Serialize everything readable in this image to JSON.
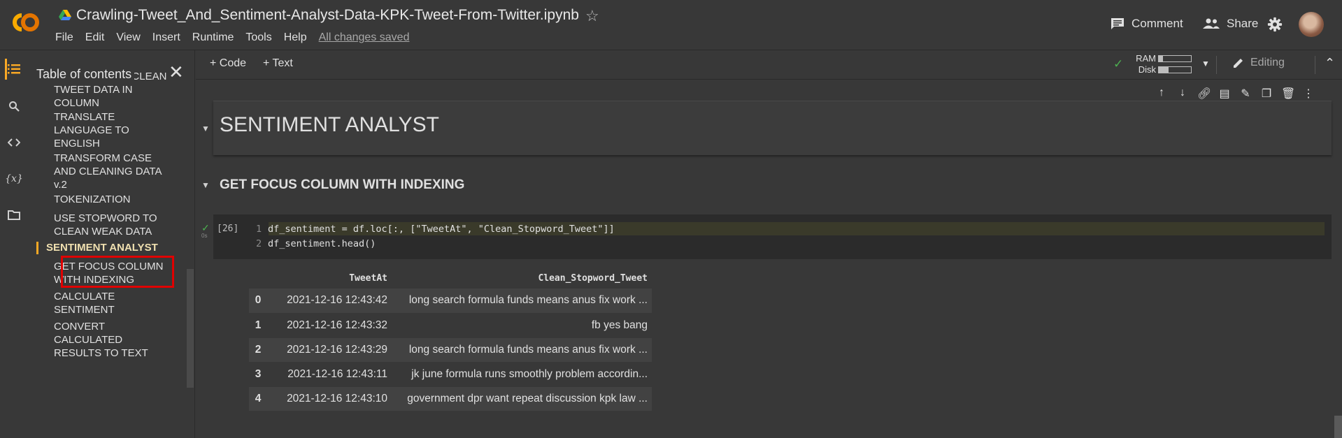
{
  "app": {
    "title": "Crawling-Tweet_And_Sentiment-Analyst-Data-KPK-Tweet-From-Twitter.ipynb",
    "menu": [
      "File",
      "Edit",
      "View",
      "Insert",
      "Runtime",
      "Tools",
      "Help"
    ],
    "save_status": "All changes saved",
    "comment_label": "Comment",
    "share_label": "Share"
  },
  "toc": {
    "title": "Table of contents",
    "items": [
      "ANALYSIS AND CLEAN TWEET DATA IN COLUMN",
      "TRANSLATE LANGUAGE TO ENGLISH",
      "TRANSFORM CASE AND CLEANING DATA v.2",
      "TOKENIZATION",
      "USE STOPWORD TO CLEAN WEAK DATA",
      "SENTIMENT ANALYST",
      "GET FOCUS COLUMN WITH INDEXING",
      "CALCULATE SENTIMENT",
      "CONVERT CALCULATED RESULTS TO TEXT"
    ]
  },
  "toolbar": {
    "code_label": "Code",
    "text_label": "Text",
    "ram_label": "RAM",
    "disk_label": "Disk",
    "ram_usage": 0.12,
    "disk_usage": 0.3,
    "editing_label": "Editing"
  },
  "notebook": {
    "heading1": "SENTIMENT ANALYST",
    "heading2": "GET FOCUS COLUMN WITH INDEXING",
    "exec_count": "[26]",
    "code_lines": [
      "df_sentiment = df.loc[:, [\"TweetAt\", \"Clean_Stopword_Tweet\"]]",
      "df_sentiment.head()"
    ],
    "line_numbers": [
      "1",
      "2"
    ]
  },
  "output": {
    "columns": [
      "TweetAt",
      "Clean_Stopword_Tweet"
    ],
    "rows": [
      [
        "0",
        "2021-12-16 12:43:42",
        "long search formula funds means anus fix work ..."
      ],
      [
        "1",
        "2021-12-16 12:43:32",
        "fb yes bang"
      ],
      [
        "2",
        "2021-12-16 12:43:29",
        "long search formula funds means anus fix work ..."
      ],
      [
        "3",
        "2021-12-16 12:43:11",
        "jk june formula runs smoothly problem accordin..."
      ],
      [
        "4",
        "2021-12-16 12:43:10",
        "government dpr want repeat discussion kpk law ..."
      ]
    ]
  },
  "colors": {
    "accent": "#f9a825",
    "highlight_box": "#e00000",
    "connected": "#4caf50"
  }
}
